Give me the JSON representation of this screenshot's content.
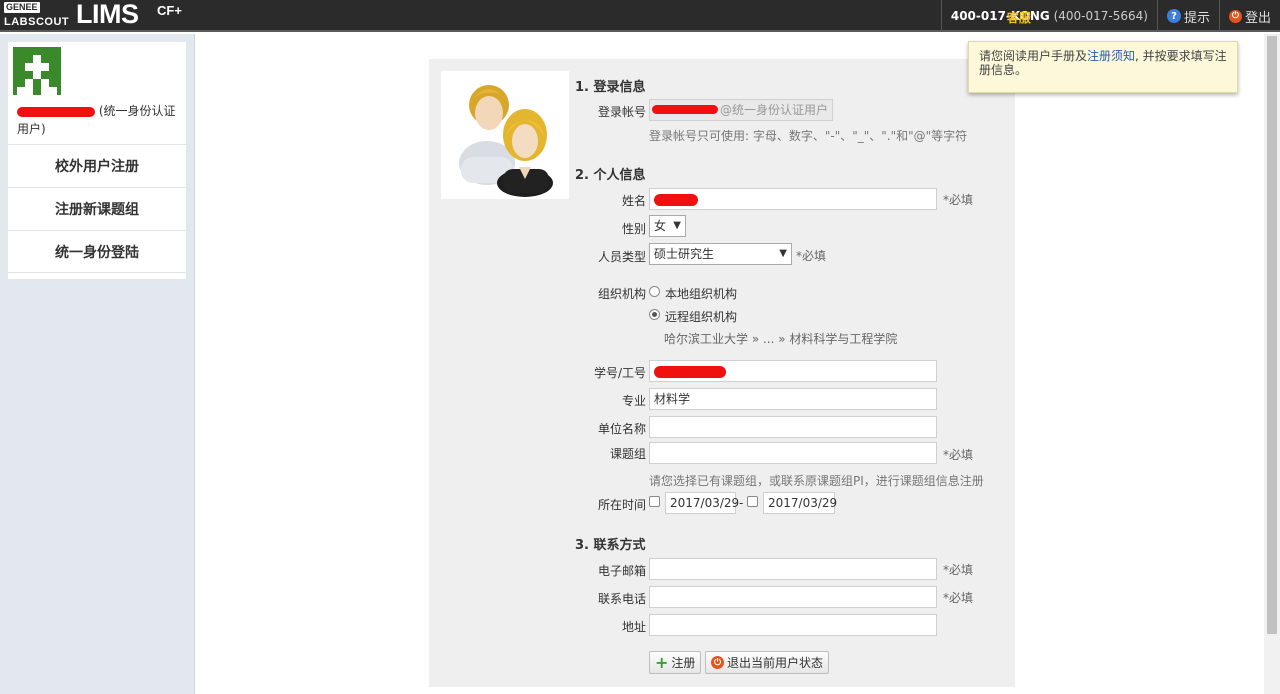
{
  "header": {
    "logo_genee": "GENEE",
    "logo_labscout": "LABSCOUT",
    "logo_lims": "LIMS",
    "logo_cf": "CF+",
    "hotline_label": "客服",
    "hotline_number": "400-017-KONG",
    "hotline_digits": "(400-017-5664)",
    "help_label": "提示",
    "logout_label": "登出"
  },
  "sidebar": {
    "user_suffix": "(统一身份认证用户)",
    "items": [
      {
        "label": "校外用户注册"
      },
      {
        "label": "注册新课题组"
      },
      {
        "label": "统一身份登陆"
      }
    ]
  },
  "tooltip": {
    "prefix": "请您阅读用户手册及",
    "link": "注册须知",
    "suffix": ", 并按要求填写注册信息。"
  },
  "form": {
    "sec_login": "1. 登录信息",
    "account_label": "登录帐号",
    "account_suffix": "@统一身份认证用户",
    "account_hint": "登录帐号只可使用: 字母、数字、\"-\"、\"_\"、\".\"和\"@\"等字符",
    "sec_personal": "2. 个人信息",
    "name_label": "姓名",
    "required": "*必填",
    "gender_label": "性别",
    "gender_value": "女",
    "type_label": "人员类型",
    "type_value": "硕士研究生",
    "org_label": "组织机构",
    "org_local": "本地组织机构",
    "org_remote": "远程组织机构",
    "org_path": "哈尔滨工业大学 » ... » 材料科学与工程学院",
    "id_label": "学号/工号",
    "major_label": "专业",
    "major_value": "材料学",
    "unit_label": "单位名称",
    "group_label": "课题组",
    "group_hint": "请您选择已有课题组，或联系原课题组PI，进行课题组信息注册",
    "time_label": "所在时间",
    "time_start": "2017/03/29",
    "time_dash": "-",
    "time_end": "2017/03/29",
    "sec_contact": "3. 联系方式",
    "email_label": "电子邮箱",
    "phone_label": "联系电话",
    "address_label": "地址",
    "register_btn": "注册",
    "exit_btn": "退出当前用户状态"
  }
}
